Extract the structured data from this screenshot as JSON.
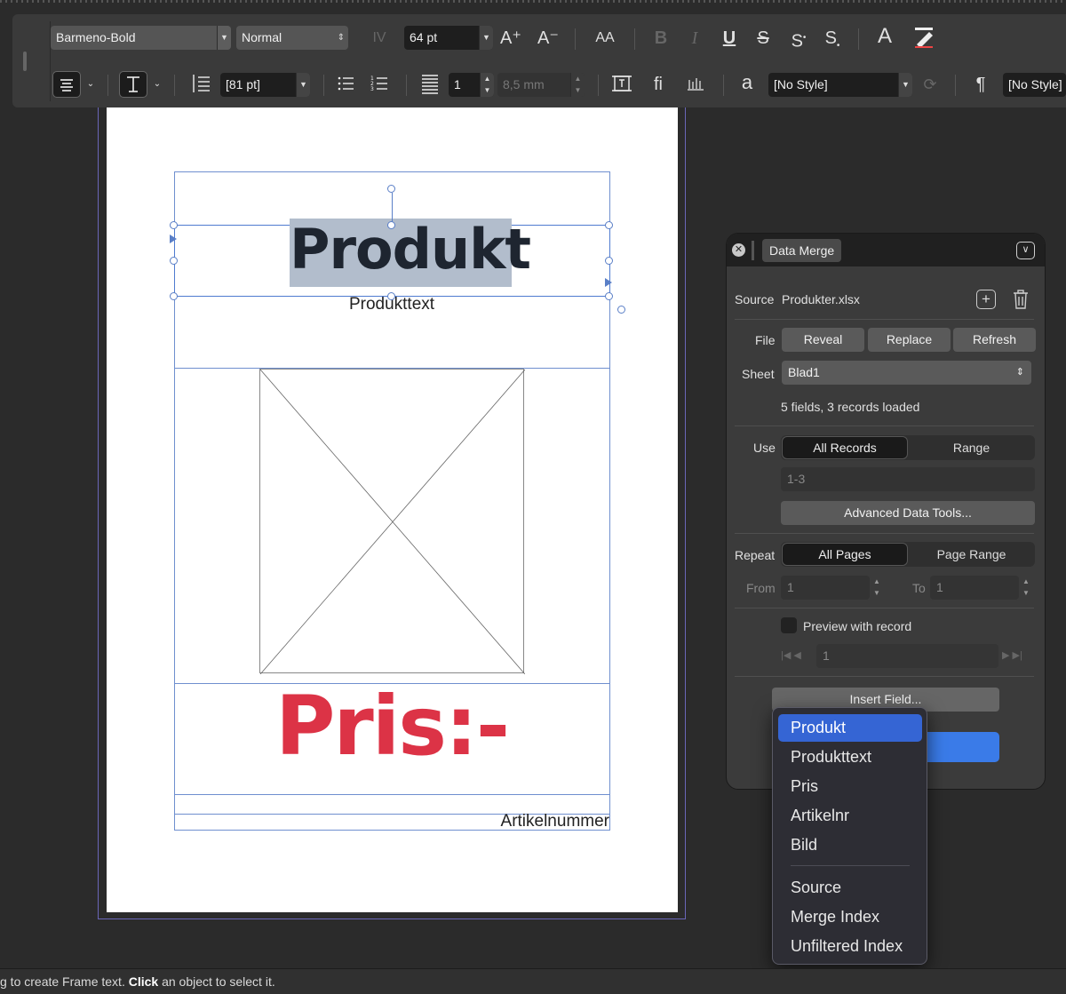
{
  "toolbar": {
    "font_family": "Barmeno-Bold",
    "font_style": "Normal",
    "font_size": "64 pt",
    "leading": "[81 pt]",
    "columns": "1",
    "gutter": "8,5 mm",
    "char_style": "[No Style]",
    "para_style": "[No Style]",
    "glyphs": {
      "tracking": "IV",
      "grow": "A⁺",
      "shrink": "A⁻",
      "allcaps": "AA",
      "bold": "B",
      "italic": "I",
      "underline": "U",
      "strike": "S",
      "superscript": "S",
      "subscript": "S",
      "text_color": "A",
      "ligature": "fi",
      "lowercase_a": "a",
      "pilcrow": "¶"
    }
  },
  "document": {
    "title_field": "Produkt",
    "subtitle_field": "Produkttext",
    "price_field": "Pris:-",
    "article_field": "Artikelnummer"
  },
  "panel": {
    "tab": "Data Merge",
    "source_label": "Source",
    "source_value": "Produkter.xlsx",
    "file_label": "File",
    "reveal": "Reveal",
    "replace": "Replace",
    "refresh": "Refresh",
    "sheet_label": "Sheet",
    "sheet_value": "Blad1",
    "status": "5 fields, 3 records loaded",
    "use_label": "Use",
    "use_all": "All Records",
    "use_range": "Range",
    "range_value": "1-3",
    "advanced": "Advanced Data Tools...",
    "repeat_label": "Repeat",
    "repeat_all": "All Pages",
    "repeat_range": "Page Range",
    "from_label": "From",
    "from_value": "1",
    "to_label": "To",
    "to_value": "1",
    "preview_label": "Preview with record",
    "preview_value": "1",
    "insert_field": "Insert Field..."
  },
  "menu": {
    "items": [
      "Produkt",
      "Produkttext",
      "Pris",
      "Artikelnr",
      "Bild"
    ],
    "extra": [
      "Source",
      "Merge Index",
      "Unfiltered Index"
    ]
  },
  "status": {
    "prefix": "g to create Frame text. ",
    "click": "Click",
    "suffix": " an object to select it."
  },
  "colors": {
    "accent": "#3565d4",
    "price_red": "#dc3346",
    "frame_blue": "#6f8fcf"
  }
}
